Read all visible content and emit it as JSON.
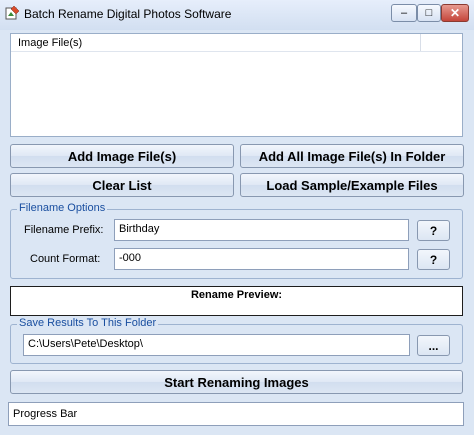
{
  "window": {
    "title": "Batch Rename Digital Photos Software"
  },
  "title_controls": {
    "minimize": "–",
    "maximize": "□",
    "close": "✕"
  },
  "file_list": {
    "column_header": "Image File(s)"
  },
  "buttons": {
    "add_files": "Add Image File(s)",
    "add_folder": "Add All Image File(s) In Folder",
    "clear_list": "Clear List",
    "load_sample": "Load Sample/Example Files",
    "start": "Start Renaming Images",
    "browse": "..."
  },
  "filename_options": {
    "group_label": "Filename Options",
    "prefix_label": "Filename Prefix:",
    "prefix_value": "Birthday",
    "prefix_help": "?",
    "count_label": "Count Format:",
    "count_value": "-000",
    "count_help": "?"
  },
  "rename_preview": {
    "label": "Rename Preview:"
  },
  "save_folder": {
    "group_label": "Save Results To This Folder",
    "path": "C:\\Users\\Pete\\Desktop\\"
  },
  "progress": {
    "label": "Progress Bar"
  }
}
